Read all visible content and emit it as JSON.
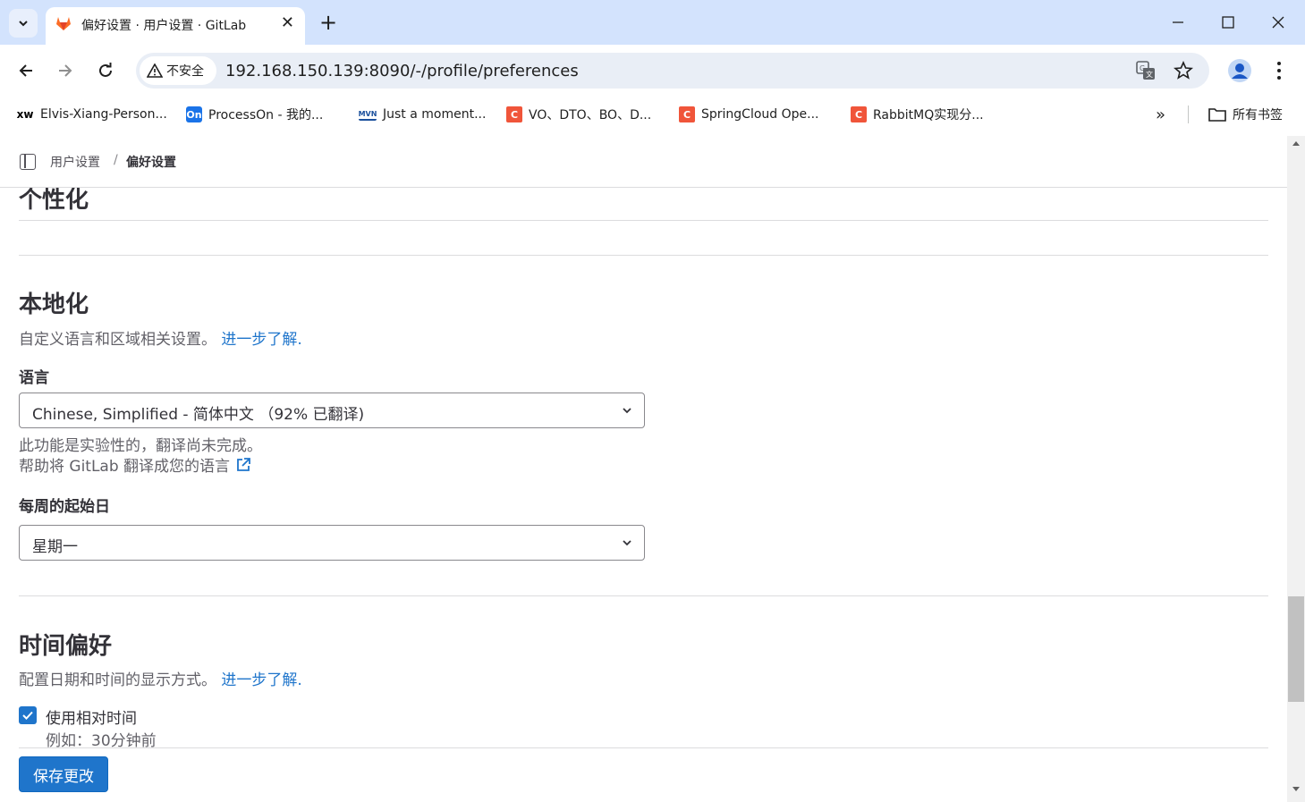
{
  "browser": {
    "tab_title": "偏好设置 · 用户设置 · GitLab",
    "security_label": "不安全",
    "url": "192.168.150.139:8090/-/profile/preferences",
    "bookmarks": [
      {
        "icon": "xw",
        "label": "Elvis-Xiang-Person..."
      },
      {
        "icon": "On",
        "label": "ProcessOn - 我的..."
      },
      {
        "icon": "MVN",
        "label": "Just a moment..."
      },
      {
        "icon": "C",
        "label": "VO、DTO、BO、D..."
      },
      {
        "icon": "C",
        "label": "SpringCloud Ope..."
      },
      {
        "icon": "C",
        "label": "RabbitMQ实现分..."
      }
    ],
    "bookmarks_folder": "所有书签",
    "more_bookmarks": "»"
  },
  "breadcrumb": {
    "parent": "用户设置",
    "separator": "/",
    "current": "偏好设置"
  },
  "sections": {
    "personalization": {
      "title": "个性化"
    },
    "localization": {
      "title": "本地化",
      "description": "自定义语言和区域相关设置。",
      "learn_more": "进一步了解.",
      "language_label": "语言",
      "language_value": "Chinese, Simplified - 简体中文 （92% 已翻译)",
      "language_help": "此功能是实验性的，翻译尚未完成。",
      "translate_link": "帮助将 GitLab 翻译成您的语言",
      "week_start_label": "每周的起始日",
      "week_start_value": "星期一"
    },
    "time": {
      "title": "时间偏好",
      "description": "配置日期和时间的显示方式。",
      "learn_more": "进一步了解.",
      "relative_time_label": "使用相对时间",
      "relative_time_checked": true,
      "relative_time_example": "例如：30分钟前"
    }
  },
  "footer": {
    "save_label": "保存更改"
  },
  "colors": {
    "accent": "#1f75cb",
    "tab_bar": "#d3e3fd",
    "omnibox": "#e9eef6"
  }
}
